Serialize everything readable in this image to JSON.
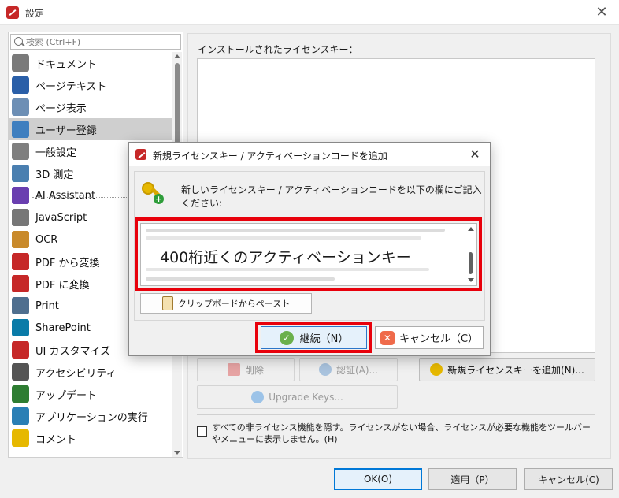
{
  "window": {
    "title": "設定",
    "close_glyph": "✕"
  },
  "sidebar": {
    "search_placeholder": "検索 (Ctrl+F)",
    "items": [
      {
        "label": "ドキュメント",
        "icon": "document-icon",
        "color": "#7a7a7a"
      },
      {
        "label": "ページテキスト",
        "icon": "page-text-icon",
        "color": "#2a5fa8"
      },
      {
        "label": "ページ表示",
        "icon": "page-view-icon",
        "color": "#6d8fb5"
      },
      {
        "label": "ユーザー登録",
        "icon": "user-registration-icon",
        "color": "#3f7fbf",
        "selected": true
      },
      {
        "label": "一般設定",
        "icon": "general-settings-icon",
        "color": "#7f7f7f"
      },
      {
        "label": "3D 測定",
        "icon": "3d-measure-icon",
        "color": "#4a7fb0"
      },
      {
        "label": "AI Assistant",
        "icon": "ai-assistant-icon",
        "color": "#6a3fb0"
      },
      {
        "label": "JavaScript",
        "icon": "javascript-icon",
        "color": "#777777"
      },
      {
        "label": "OCR",
        "icon": "ocr-icon",
        "color": "#c98a2b"
      },
      {
        "label": "PDF から変換",
        "icon": "convert-from-pdf-icon",
        "color": "#c62828"
      },
      {
        "label": "PDF に変換",
        "icon": "convert-to-pdf-icon",
        "color": "#c62828"
      },
      {
        "label": "Print",
        "icon": "print-icon",
        "color": "#4f6f8f"
      },
      {
        "label": "SharePoint",
        "icon": "sharepoint-icon",
        "color": "#0a7ba8"
      },
      {
        "label": "UI カスタマイズ",
        "icon": "ui-customize-icon",
        "color": "#c62828"
      },
      {
        "label": "アクセシビリティ",
        "icon": "accessibility-icon",
        "color": "#555555"
      },
      {
        "label": "アップデート",
        "icon": "update-icon",
        "color": "#2e7d32"
      },
      {
        "label": "アプリケーションの実行",
        "icon": "run-application-icon",
        "color": "#2a7fb5"
      },
      {
        "label": "コメント",
        "icon": "comment-icon",
        "color": "#e6b800"
      }
    ]
  },
  "main": {
    "installed_keys_label": "インストールされたライセンスキー：",
    "delete_label": "削除",
    "authenticate_label": "認証(A)...",
    "add_key_label": "新規ライセンスキーを追加(N)...",
    "upgrade_label": "Upgrade Keys...",
    "hide_unlicensed_label": "すべての非ライセンス機能を隠す。ライセンスがない場合、ライセンスが必要な機能をツールバーやメニューに表示しません。(H)"
  },
  "footer": {
    "ok_label": "OK(O)",
    "apply_label": "適用（P）",
    "cancel_label": "キャンセル(C)"
  },
  "dialog": {
    "title": "新規ライセンスキー / アクティベーションコードを追加",
    "close_glyph": "✕",
    "instruction": "新しいライセンスキー / アクティベーションコードを以下の欄にご記入ください:",
    "key_overlay_text": "400桁近くのアクティベーションキー",
    "paste_label": "クリップボードからペースト",
    "continue_label": "継続（N）",
    "cancel_label": "キャンセル（C）",
    "ok_glyph": "✓",
    "cancel_glyph": "✕",
    "add_glyph": "+"
  },
  "colors": {
    "highlight_red": "#e8000b",
    "primary_blue": "#0078d7",
    "selected_bg": "#cfcfcf"
  }
}
